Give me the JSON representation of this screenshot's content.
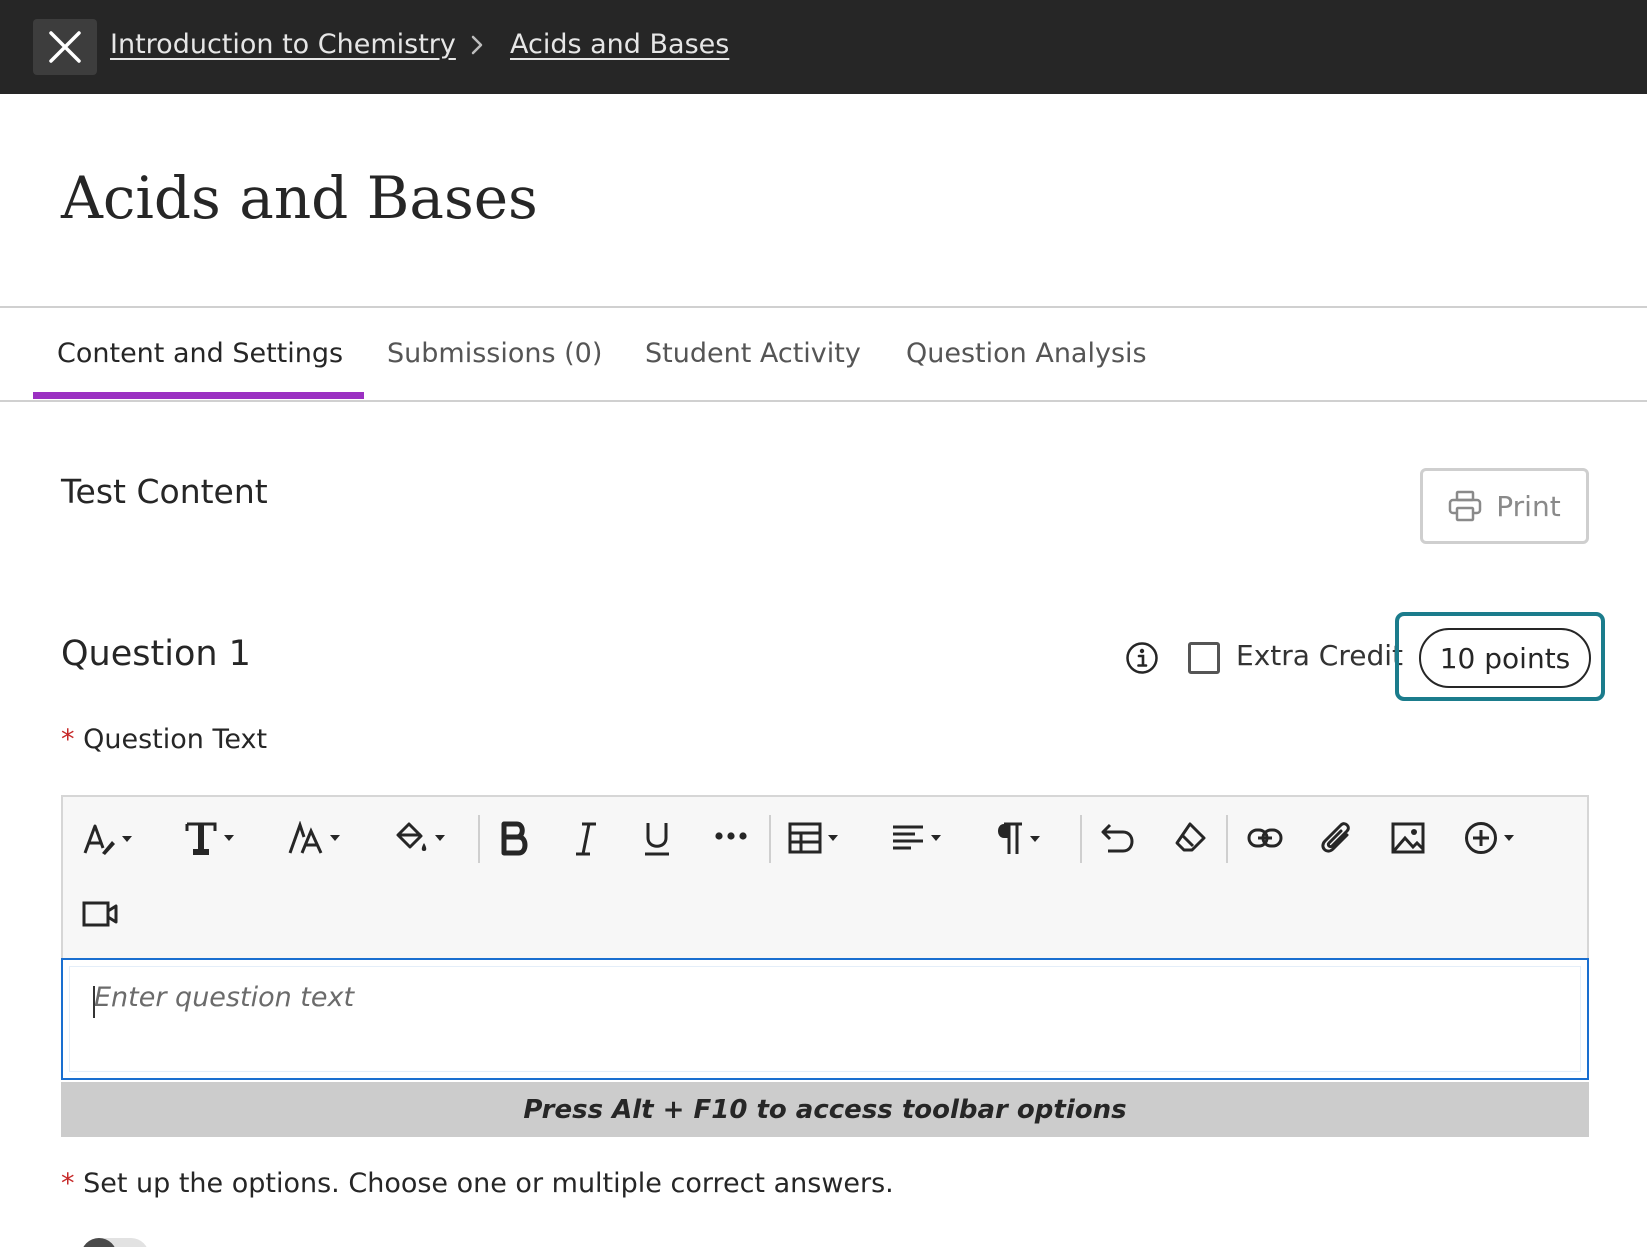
{
  "breadcrumb": {
    "course": "Introduction to Chemistry",
    "item": "Acids and Bases"
  },
  "page": {
    "title": "Acids and Bases"
  },
  "tabs": [
    {
      "label": "Content and Settings",
      "active": true
    },
    {
      "label": "Submissions (0)",
      "active": false
    },
    {
      "label": "Student Activity",
      "active": false
    },
    {
      "label": "Question Analysis",
      "active": false
    }
  ],
  "section": {
    "title": "Test Content",
    "print_label": "Print"
  },
  "question": {
    "title": "Question 1",
    "extra_credit_label": "Extra Credit",
    "extra_credit_checked": false,
    "points": "10 points",
    "text_label": "Question Text",
    "required_marker": "*",
    "editor_placeholder": "Enter question text",
    "editor_hint": "Press Alt + F10 to access toolbar options",
    "options_label": "Set up the options. Choose one or multiple correct answers."
  },
  "toolbar_icons": [
    "text-style-icon",
    "font-family-icon",
    "font-size-icon",
    "highlight-color-icon",
    "bold-icon",
    "italic-icon",
    "underline-icon",
    "more-icon",
    "table-icon",
    "align-icon",
    "paragraph-icon",
    "undo-icon",
    "clear-format-icon",
    "link-icon",
    "attach-icon",
    "image-icon",
    "insert-content-icon",
    "video-icon"
  ],
  "colors": {
    "topbar": "#262626",
    "tab_accent": "#9b30c2",
    "focus_ring": "#1b7c8c",
    "required": "#c62828",
    "editor_border": "#1a6fd0"
  }
}
